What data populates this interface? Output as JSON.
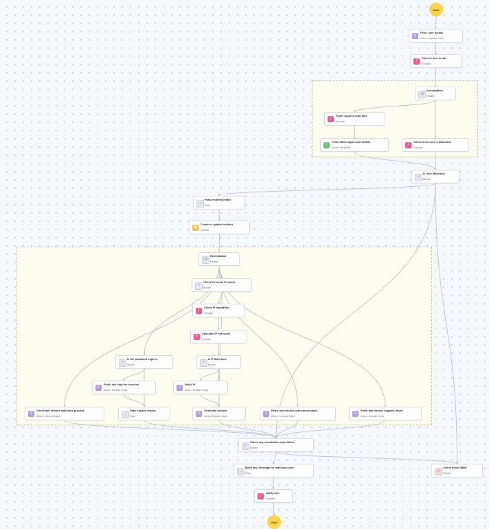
{
  "colors": {
    "script": "#b39ddb",
    "function": "#f05590",
    "parallel": "#e3e6ee",
    "branch": "#e3e6ee",
    "pass": "#e3e6ee",
    "condit": "#f5c04a",
    "alerts": "#6cc070",
    "failure": "#f5d6d6",
    "edge": "#b5bcc6",
    "terminal": "#fcd34d"
  },
  "start": {
    "label": "Start"
  },
  "end": {
    "label": "End"
  },
  "groups": {
    "investigation": "investigation",
    "remediation": "remediation"
  },
  "nodes": [
    {
      "id": "fetch-user",
      "title": "Fetch user details",
      "sub": "Action: Execute Script",
      "kind": "script",
      "icon": "script-icon"
    },
    {
      "id": "convert-time",
      "title": "Convert time to utc",
      "sub": "Function",
      "kind": "function",
      "icon": "function-icon"
    },
    {
      "id": "investigation",
      "title": "Investigation",
      "sub": "Parallel",
      "kind": "parallel",
      "icon": "parallel-icon"
    },
    {
      "id": "fetch-start",
      "title": "Fetch required start time",
      "sub": "Function",
      "kind": "function",
      "icon": "function-icon"
    },
    {
      "id": "fetch-failed",
      "title": "Fetch failed logon alert details",
      "sub": "Action: Get Alerts",
      "kind": "alerts",
      "icon": "alerts-icon"
    },
    {
      "id": "check-malicious",
      "title": "Check if the user is malicious",
      "sub": "Function",
      "kind": "function",
      "icon": "function-icon"
    },
    {
      "id": "is-user-malicious",
      "title": "Is User Malicious",
      "sub": "Branch",
      "kind": "branch",
      "icon": "branch-icon"
    },
    {
      "id": "pass-incident",
      "title": "Pass Incident details",
      "sub": "Pass",
      "kind": "pass",
      "icon": "pass-icon"
    },
    {
      "id": "create-incident",
      "title": "Create or update incident",
      "sub": "Conduit",
      "kind": "condit",
      "icon": "conduit-icon"
    },
    {
      "id": "remediation",
      "title": "Remediation",
      "sub": "Parallel",
      "kind": "parallel",
      "icon": "parallel-icon"
    },
    {
      "id": "check-remote-ip",
      "title": "Check if remote IP exists",
      "sub": "Branch",
      "kind": "branch",
      "icon": "branch-icon"
    },
    {
      "id": "check-ip-rep",
      "title": "Check IP reputation",
      "sub": "Function",
      "kind": "function",
      "icon": "function-icon"
    },
    {
      "id": "calc-ip-risk",
      "title": "Calculate IP risk score",
      "sub": "Function",
      "kind": "function",
      "icon": "function-icon"
    },
    {
      "id": "is-pw-expires",
      "title": "Is the password expires",
      "sub": "Branch",
      "kind": "branch",
      "icon": "branch-icon"
    },
    {
      "id": "is-ip-malicious",
      "title": "Is IP Malicious",
      "sub": "Branch",
      "kind": "branch",
      "icon": "branch-icon"
    },
    {
      "id": "fetch-stop-services",
      "title": "Fetch and stop the services",
      "sub": "Action: Execute Script",
      "kind": "script",
      "icon": "script-icon"
    },
    {
      "id": "block-ip",
      "title": "Block IP",
      "sub": "Action: Execute Script",
      "kind": "script",
      "icon": "script-icon"
    },
    {
      "id": "check-remove-process",
      "title": "Check and remove malicious process",
      "sub": "Action: Execute Script",
      "kind": "script",
      "icon": "script-icon"
    },
    {
      "id": "pass-expired",
      "title": "Pass expired results",
      "sub": "Pass",
      "kind": "pass",
      "icon": "pass-icon"
    },
    {
      "id": "terminate-session",
      "title": "Terminate session",
      "sub": "Action: Execute Script",
      "kind": "script",
      "icon": "script-icon"
    },
    {
      "id": "fetch-persistence",
      "title": "Fetch and remove persistence tasks",
      "sub": "Action: Execute Script",
      "kind": "script",
      "icon": "script-icon"
    },
    {
      "id": "fetch-mapped",
      "title": "Fetch and remove mapped drives",
      "sub": "Action: Execute Script",
      "kind": "script",
      "icon": "script-icon"
    },
    {
      "id": "check-any-failed",
      "title": "Check any remediation state failed",
      "sub": "Branch",
      "kind": "branch",
      "icon": "branch-icon"
    },
    {
      "id": "build-mail",
      "title": "Build mail message for malicious user",
      "sub": "Pass",
      "kind": "pass",
      "icon": "pass-icon"
    },
    {
      "id": "action-failed",
      "title": "Action block failed",
      "sub": "Failure",
      "kind": "failure",
      "icon": "failure-icon"
    },
    {
      "id": "notify-user",
      "title": "Notify user",
      "sub": "Function",
      "kind": "function",
      "icon": "function-icon"
    }
  ],
  "edges": [
    [
      "start",
      "fetch-user"
    ],
    [
      "fetch-user",
      "convert-time"
    ],
    [
      "convert-time",
      "investigation"
    ],
    [
      "investigation",
      "fetch-start"
    ],
    [
      "fetch-start",
      "fetch-failed"
    ],
    [
      "investigation",
      "check-malicious"
    ],
    [
      "fetch-failed",
      "is-user-malicious"
    ],
    [
      "check-malicious",
      "is-user-malicious"
    ],
    [
      "is-user-malicious",
      "pass-incident"
    ],
    [
      "pass-incident",
      "create-incident"
    ],
    [
      "create-incident",
      "remediation"
    ],
    [
      "remediation",
      "check-remote-ip"
    ],
    [
      "check-remote-ip",
      "check-ip-rep"
    ],
    [
      "check-ip-rep",
      "calc-ip-risk"
    ],
    [
      "calc-ip-risk",
      "is-ip-malicious"
    ],
    [
      "is-ip-malicious",
      "block-ip"
    ],
    [
      "block-ip",
      "terminate-session"
    ],
    [
      "is-ip-malicious",
      "terminate-session"
    ],
    [
      "check-remote-ip",
      "terminate-session"
    ],
    [
      "remediation",
      "is-pw-expires"
    ],
    [
      "is-pw-expires",
      "fetch-stop-services"
    ],
    [
      "fetch-stop-services",
      "pass-expired"
    ],
    [
      "is-pw-expires",
      "pass-expired"
    ],
    [
      "remediation",
      "check-remove-process"
    ],
    [
      "remediation",
      "fetch-persistence"
    ],
    [
      "remediation",
      "fetch-mapped"
    ],
    [
      "check-remove-process",
      "check-any-failed"
    ],
    [
      "pass-expired",
      "check-any-failed"
    ],
    [
      "terminate-session",
      "check-any-failed"
    ],
    [
      "fetch-persistence",
      "check-any-failed"
    ],
    [
      "fetch-mapped",
      "check-any-failed"
    ],
    [
      "is-user-malicious",
      "check-any-failed"
    ],
    [
      "check-any-failed",
      "build-mail"
    ],
    [
      "check-any-failed",
      "action-failed"
    ],
    [
      "is-user-malicious",
      "action-failed"
    ],
    [
      "build-mail",
      "notify-user"
    ],
    [
      "notify-user",
      "end"
    ]
  ]
}
